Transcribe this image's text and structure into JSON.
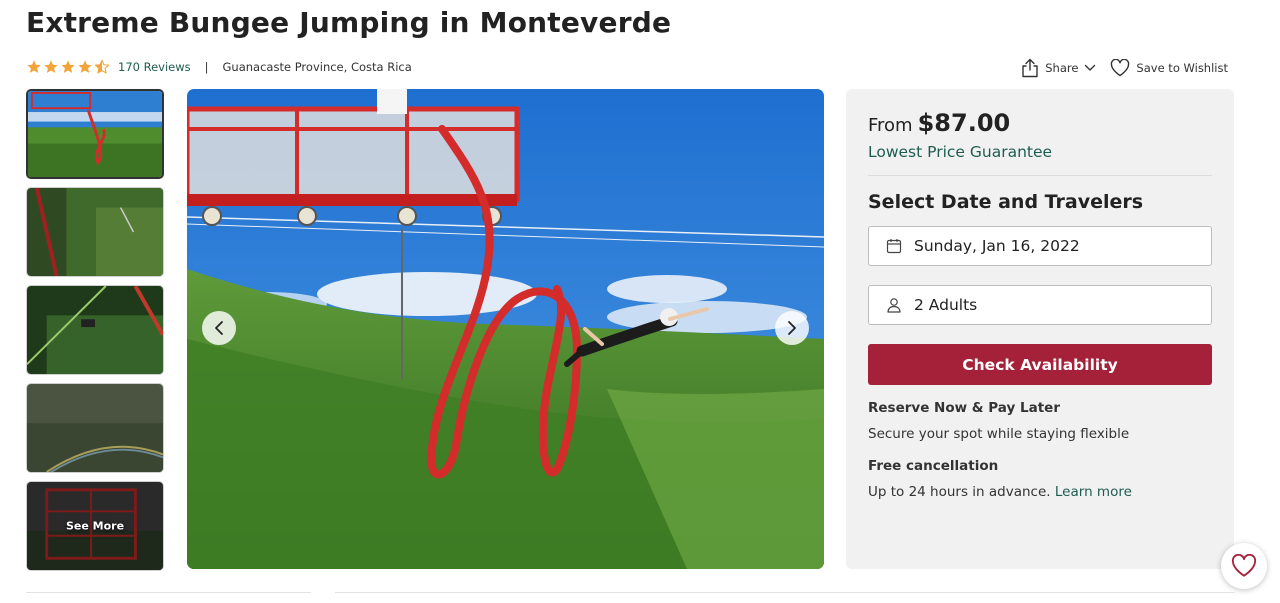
{
  "page": {
    "title": "Extreme Bungee Jumping in Monteverde"
  },
  "meta": {
    "rating": 4.5,
    "reviews": "170 Reviews",
    "separator": "|",
    "location": "Guanacaste Province, Costa Rica"
  },
  "actions": {
    "share": "Share",
    "wishlist": "Save to Wishlist"
  },
  "gallery": {
    "thumbnails": [
      "bungee platform",
      "canyon forest",
      "jumper on cord",
      "misty rainbow",
      "bungee tower"
    ],
    "see_more": "See More",
    "active_index": 0
  },
  "booking": {
    "from_label": "From",
    "price": "$87.00",
    "guarantee": "Lowest Price Guarantee",
    "select_title": "Select Date and Travelers",
    "date": "Sunday, Jan 16, 2022",
    "travelers": "2 Adults",
    "cta": "Check Availability",
    "reserve_title": "Reserve Now & Pay Later",
    "reserve_text": "Secure your spot while staying flexible",
    "cancel_title": "Free cancellation",
    "cancel_text": "Up to 24 hours in advance.",
    "learn_more": "Learn more"
  },
  "colors": {
    "accent_green": "#1d5d4f",
    "cta_red": "#a5213a",
    "star_orange": "#f2a33a",
    "panel_bg": "#f1f1f1"
  }
}
